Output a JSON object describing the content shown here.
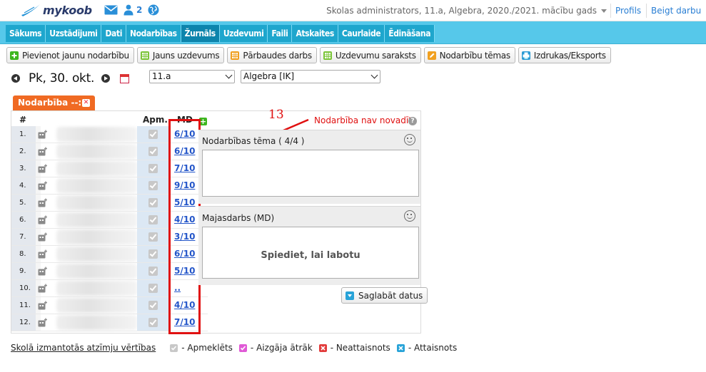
{
  "header": {
    "logo_text": "mykoob",
    "people_count": "2",
    "school_info": "Skolas administrators, 11.a, Algebra, 2020./2021. mācību gads",
    "profile_link": "Profils",
    "logout_link": "Beigt darbu"
  },
  "nav": {
    "items": [
      {
        "label": "Sākums"
      },
      {
        "label": "Uzstādījumi"
      },
      {
        "label": "Dati"
      },
      {
        "label": "Nodarbības"
      },
      {
        "label": "Žurnāls"
      },
      {
        "label": "Uzdevumi"
      },
      {
        "label": "Faili"
      },
      {
        "label": "Atskaites"
      },
      {
        "label": "Caurlaide"
      },
      {
        "label": "Ēdināšana"
      }
    ]
  },
  "toolbar": {
    "buttons": [
      {
        "label": "Pievienot jaunu nodarbību",
        "icon": "plus-green-icon",
        "color": "#3db61f"
      },
      {
        "label": "Jauns uzdevums",
        "icon": "grid-icon",
        "color": "#7cc53a"
      },
      {
        "label": "Pārbaudes darbs",
        "icon": "grid-icon",
        "color": "#f0a020"
      },
      {
        "label": "Uzdevumu saraksts",
        "icon": "grid-icon",
        "color": "#7cc53a"
      },
      {
        "label": "Nodarbību tēmas",
        "icon": "pencil-icon",
        "color": "#f0a020"
      },
      {
        "label": "Izdrukas/Eksports",
        "icon": "printer-icon",
        "color": "#2a9bd4"
      }
    ]
  },
  "date_nav": {
    "date": "Pk, 30. okt.",
    "class_select": "11.a",
    "subject_select": "Algebra [IK]"
  },
  "lesson_tab": {
    "label": "Nodarbība --:--"
  },
  "table": {
    "col_num": "#",
    "col_apm": "Apm.",
    "col_md": "MD",
    "rows": [
      {
        "num": "1.",
        "grade": "6/10"
      },
      {
        "num": "2.",
        "grade": "6/10"
      },
      {
        "num": "3.",
        "grade": "7/10"
      },
      {
        "num": "4.",
        "grade": "9/10"
      },
      {
        "num": "5.",
        "grade": "5/10"
      },
      {
        "num": "6.",
        "grade": "4/10"
      },
      {
        "num": "7.",
        "grade": "3/10"
      },
      {
        "num": "8.",
        "grade": "6/10"
      },
      {
        "num": "9.",
        "grade": "5/10"
      },
      {
        "num": "10.",
        "grade": ".."
      },
      {
        "num": "11.",
        "grade": "4/10"
      },
      {
        "num": "12.",
        "grade": "7/10"
      }
    ]
  },
  "annotation": {
    "number": "13",
    "color": "#e01010"
  },
  "lesson_status": "Nodarbība nav novadīta",
  "topic_section": {
    "title": "Nodarbības tēma ( 4/4 )"
  },
  "homework_section": {
    "title": "Majasdarbs (MD)",
    "placeholder": "Spiediet, lai labotu"
  },
  "save_button": "Saglabāt datus",
  "legend": {
    "link": "Skolā izmantotās atzīmju vērtības",
    "items": [
      {
        "label": "- Apmeklēts",
        "color": "#c8c8c8"
      },
      {
        "label": "- Aizgāja ātrāk",
        "color": "#e05ad6"
      },
      {
        "label": "- Neattaisnots",
        "color": "#e23b3b"
      },
      {
        "label": "- Attaisnots",
        "color": "#28a3d8"
      }
    ]
  }
}
